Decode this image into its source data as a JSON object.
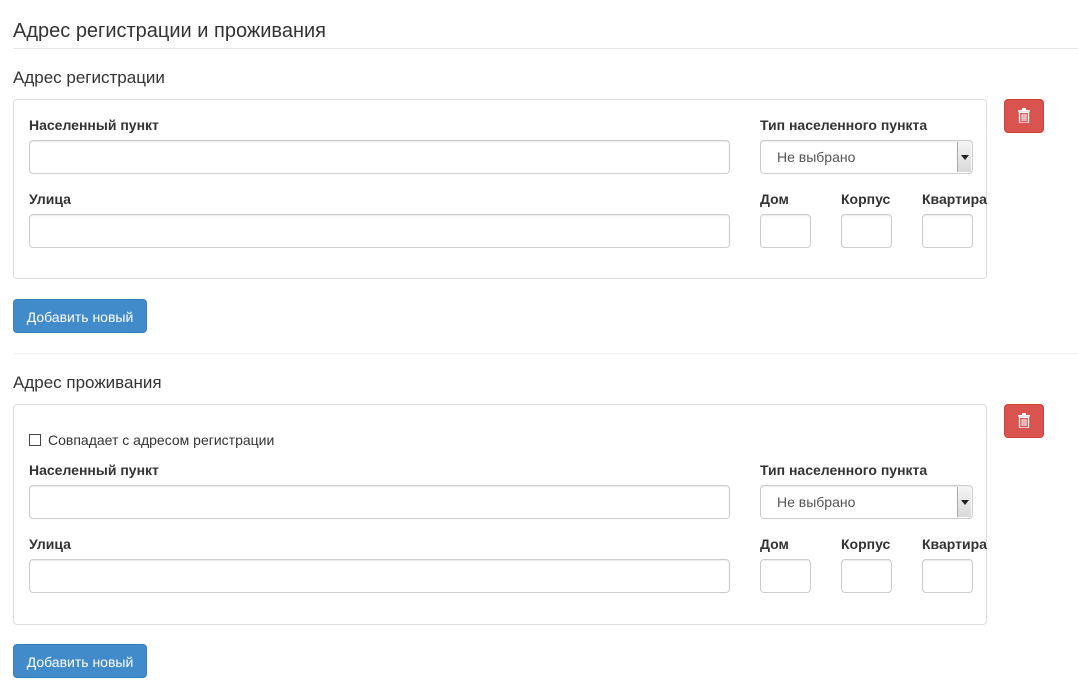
{
  "page": {
    "title": "Адрес регистрации и проживания"
  },
  "registration": {
    "title": "Адрес регистрации",
    "settlement_label": "Населенный пункт",
    "settlement_value": "",
    "settlement_type_label": "Тип населенного пункта",
    "settlement_type_value": "Не выбрано",
    "street_label": "Улица",
    "street_value": "",
    "house_label": "Дом",
    "house_value": "",
    "building_label": "Корпус",
    "building_value": "",
    "apartment_label": "Квартира",
    "apartment_value": "",
    "add_button": "Добавить новый",
    "delete_icon": "trash-icon"
  },
  "residence": {
    "title": "Адрес проживания",
    "same_as_registration_label": "Совпадает с адресом регистрации",
    "same_as_registration_checked": false,
    "settlement_label": "Населенный пункт",
    "settlement_value": "",
    "settlement_type_label": "Тип населенного пункта",
    "settlement_type_value": "Не выбрано",
    "street_label": "Улица",
    "street_value": "",
    "house_label": "Дом",
    "house_value": "",
    "building_label": "Корпус",
    "building_value": "",
    "apartment_label": "Квартира",
    "apartment_value": "",
    "add_button": "Добавить новый",
    "delete_icon": "trash-icon"
  },
  "colors": {
    "primary": "#428bca",
    "danger": "#d9534f",
    "border": "#dddddd"
  }
}
